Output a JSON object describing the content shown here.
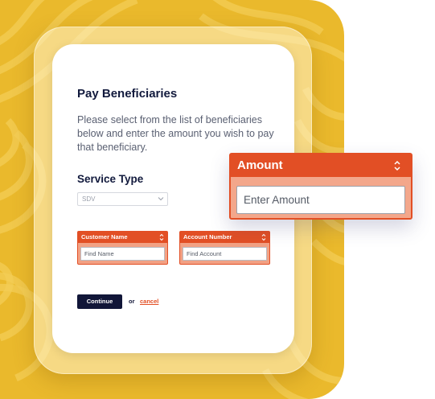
{
  "form": {
    "title": "Pay Beneficiaries",
    "description": "Please select from the list of beneficiaries below and enter the amount you wish to pay that beneficiary.",
    "service_type": {
      "label": "Service Type",
      "selected": "SDV"
    },
    "customer_name": {
      "label": "Customer Name",
      "placeholder": "Find Name"
    },
    "account_number": {
      "label": "Account Number",
      "placeholder": "Find Account"
    },
    "continue_label": "Continue",
    "or_label": "or",
    "cancel_label": "cancel"
  },
  "amount": {
    "label": "Amount",
    "placeholder": "Enter Amount"
  },
  "colors": {
    "accent": "#e24f25",
    "navy": "#111638",
    "backdrop": "#eab92c"
  },
  "icons": {
    "updown": "updown-chevron-icon",
    "select_chevron": "chevron-down-icon"
  }
}
